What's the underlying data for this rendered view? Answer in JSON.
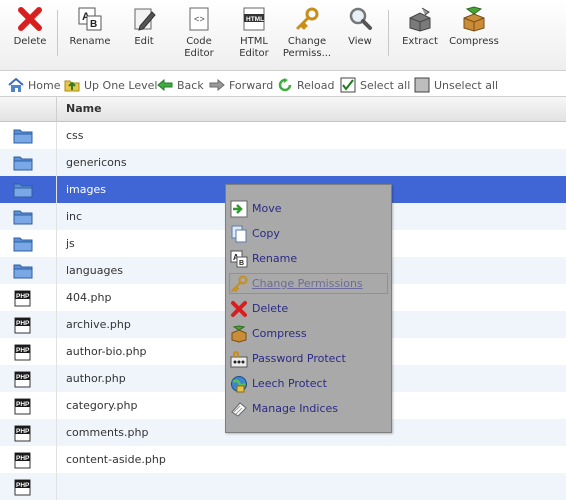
{
  "toolbar": {
    "buttons": [
      {
        "label": "Delete",
        "icon": "red-x-icon"
      },
      {
        "label": "Rename",
        "icon": "rename-icon"
      },
      {
        "label": "Edit",
        "icon": "pencil-icon"
      },
      {
        "label": "Code\nEditor",
        "icon": "code-editor-icon"
      },
      {
        "label": "HTML\nEditor",
        "icon": "html-editor-icon"
      },
      {
        "label": "Change\nPermiss...",
        "icon": "key-icon"
      },
      {
        "label": "View",
        "icon": "magnifier-icon"
      },
      {
        "label": "Extract",
        "icon": "extract-icon"
      },
      {
        "label": "Compress",
        "icon": "compress-icon"
      }
    ]
  },
  "nav": {
    "home": "Home",
    "up": "Up One Level",
    "back": "Back",
    "forward": "Forward",
    "reload": "Reload",
    "select_all": "Select all",
    "unselect_all": "Unselect all"
  },
  "table": {
    "header_name": "Name",
    "rows": [
      {
        "name": "css",
        "type": "folder"
      },
      {
        "name": "genericons",
        "type": "folder"
      },
      {
        "name": "images",
        "type": "folder",
        "selected": true
      },
      {
        "name": "inc",
        "type": "folder"
      },
      {
        "name": "js",
        "type": "folder"
      },
      {
        "name": "languages",
        "type": "folder"
      },
      {
        "name": "404.php",
        "type": "php"
      },
      {
        "name": "archive.php",
        "type": "php"
      },
      {
        "name": "author-bio.php",
        "type": "php"
      },
      {
        "name": "author.php",
        "type": "php"
      },
      {
        "name": "category.php",
        "type": "php"
      },
      {
        "name": "comments.php",
        "type": "php"
      },
      {
        "name": "content-aside.php",
        "type": "php"
      },
      {
        "name": "",
        "type": "php"
      }
    ]
  },
  "icons": {
    "php_label": "PHP",
    "html_label": "HTML",
    "code_label": "<>",
    "rename_a": "A",
    "rename_b": "B"
  },
  "context_menu": {
    "items": [
      {
        "label": "Move",
        "icon": "move-icon"
      },
      {
        "label": "Copy",
        "icon": "copy-icon"
      },
      {
        "label": "Rename",
        "icon": "rename-icon"
      },
      {
        "label": "Change Permissions",
        "icon": "key-icon",
        "disabled": true
      },
      {
        "label": "Delete",
        "icon": "red-x-icon"
      },
      {
        "label": "Compress",
        "icon": "compress-icon"
      },
      {
        "label": "Password Protect",
        "icon": "password-icon"
      },
      {
        "label": "Leech Protect",
        "icon": "leech-icon"
      },
      {
        "label": "Manage Indices",
        "icon": "indices-icon"
      }
    ]
  }
}
